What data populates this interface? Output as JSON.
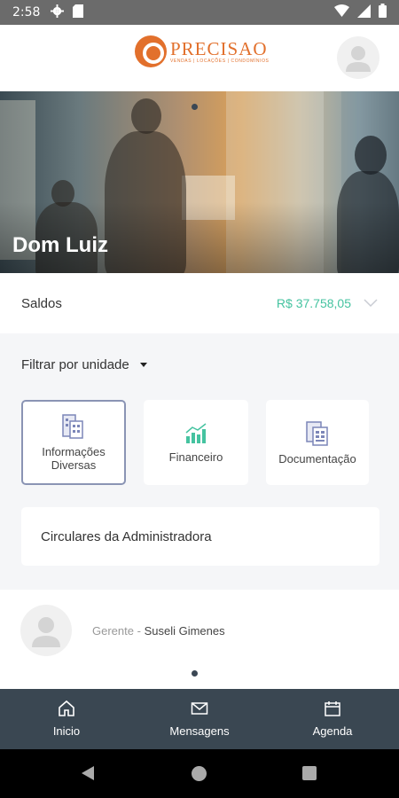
{
  "status_bar": {
    "time": "2:58"
  },
  "header": {
    "logo": {
      "word": "PRECISAO",
      "tagline": "VENDAS | LOCAÇÕES | CONDOMÍNIOS"
    }
  },
  "hero": {
    "title": "Dom Luiz"
  },
  "saldos": {
    "label": "Saldos",
    "value": "R$ 37.758,05"
  },
  "filter": {
    "label": "Filtrar por unidade"
  },
  "cards": [
    {
      "label": "Informações Diversas",
      "icon": "building-document-icon",
      "selected": true
    },
    {
      "label": "Financeiro",
      "icon": "bar-chart-icon",
      "selected": false
    },
    {
      "label": "Documentação",
      "icon": "documents-icon",
      "selected": false
    }
  ],
  "circulares": {
    "label": "Circulares da Administradora"
  },
  "manager": {
    "role": "Gerente",
    "separator": "-",
    "name": "Suseli Gimenes"
  },
  "bottom_nav": [
    {
      "label": "Inicio",
      "icon": "home-icon"
    },
    {
      "label": "Mensagens",
      "icon": "mail-icon"
    },
    {
      "label": "Agenda",
      "icon": "calendar-icon"
    }
  ],
  "colors": {
    "accent": "#45c3a0",
    "brand": "#e2702c",
    "nav_bg": "#3a4752"
  }
}
